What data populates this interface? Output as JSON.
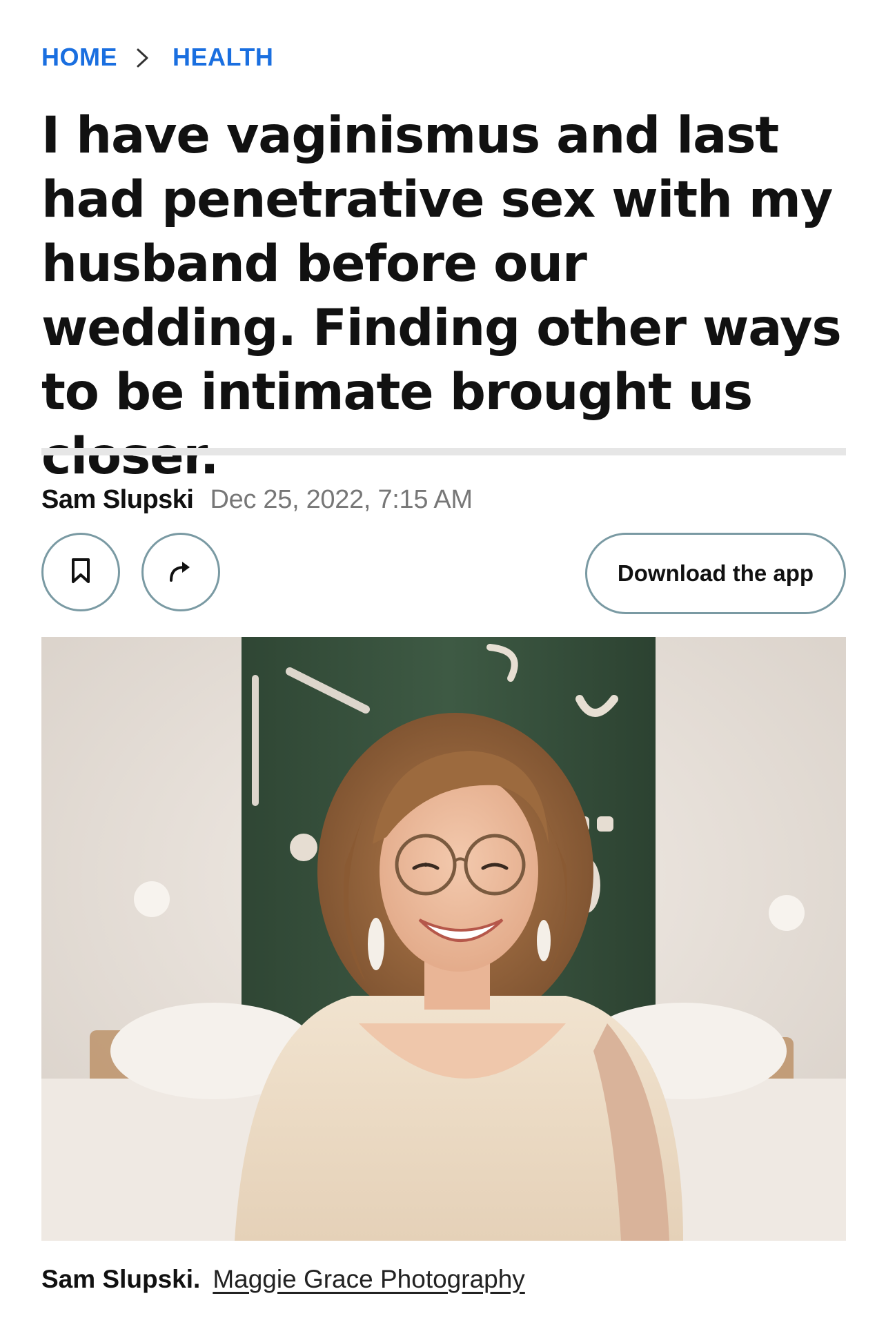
{
  "breadcrumb": {
    "home": "HOME",
    "section": "HEALTH"
  },
  "article": {
    "headline": "I have vaginismus and last had penetrative sex with my husband before our wedding. Finding other ways to be intimate brought us closer.",
    "author": "Sam Slupski",
    "date": "Dec 25, 2022, 7:15 AM"
  },
  "actions": {
    "bookmark_icon": "bookmark-icon",
    "share_icon": "share-arrow-icon",
    "download_label": "Download the app"
  },
  "photo": {
    "caption_name": "Sam Slupski.",
    "caption_credit": "Maggie Grace Photography"
  },
  "colors": {
    "link": "#1a6fe0",
    "button_border": "#7a9aa3",
    "divider": "#e6e6e6",
    "date_text": "#777777"
  }
}
